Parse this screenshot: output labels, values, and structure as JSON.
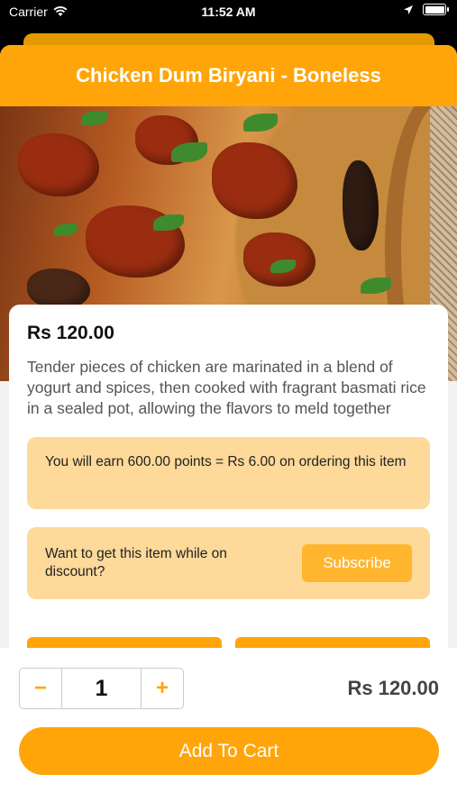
{
  "status_bar": {
    "carrier": "Carrier",
    "time": "11:52 AM"
  },
  "header": {
    "title": "Chicken Dum Biryani - Boneless"
  },
  "product": {
    "price": "Rs 120.00",
    "description": "Tender pieces of chicken are marinated in a blend of yogurt and spices, then cooked with fragrant basmati rice in a sealed pot, allowing the flavors to meld together",
    "image_alt": "biryani-photo"
  },
  "points": {
    "text": "You will earn 600.00 points = Rs 6.00 on ordering this item"
  },
  "subscribe": {
    "text": "Want to get this item while on discount?",
    "button_label": "Subscribe"
  },
  "cart": {
    "minus": "−",
    "plus": "+",
    "quantity": "1",
    "total": "Rs 120.00",
    "add_label": "Add To Cart"
  },
  "colors": {
    "accent": "#ffa50a",
    "soft_accent": "#fdd99a"
  }
}
